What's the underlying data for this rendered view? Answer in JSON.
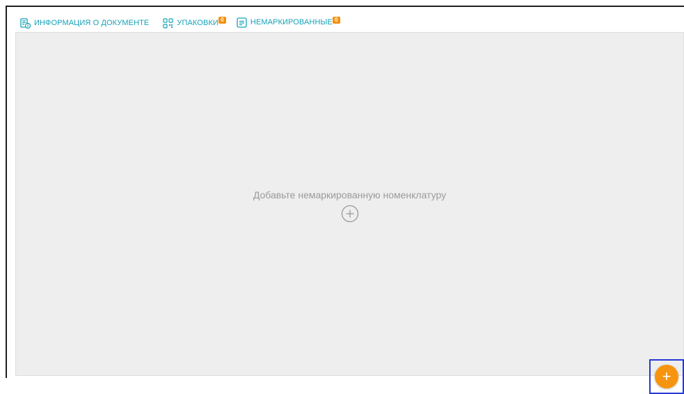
{
  "tabs": [
    {
      "label": "ИНФОРМАЦИЯ О ДОКУМЕНТЕ",
      "icon": "document-info-icon",
      "active": false
    },
    {
      "label": "УПАКОВКИ",
      "icon": "qr-code-icon",
      "badge": "0",
      "active": false
    },
    {
      "label": "НЕМАРКИРОВАННЫЕ",
      "icon": "list-icon",
      "badge": "0",
      "active": true
    }
  ],
  "empty_state": {
    "text": "Добавьте немаркированную номенклатуру",
    "icon": "plus-circle-icon"
  },
  "fab": {
    "label": "+",
    "icon": "plus-icon"
  },
  "colors": {
    "accent": "#14a3b8",
    "badge": "#f5900e",
    "fab": "#f7940f",
    "content_bg": "#eeeeee",
    "highlight": "#2438d6"
  }
}
